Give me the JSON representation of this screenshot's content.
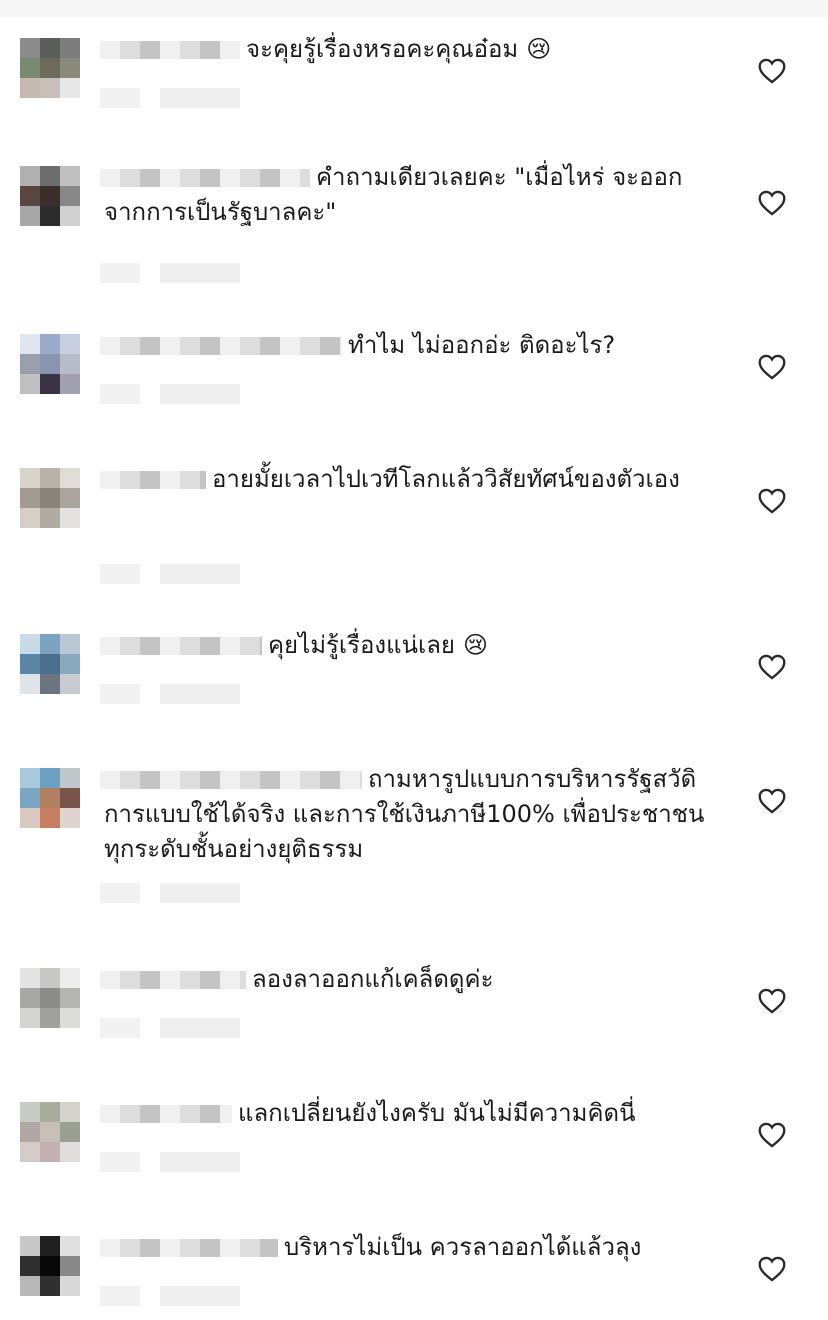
{
  "header": {
    "background": "#f7f7f7"
  },
  "colors": {
    "pixel_shades": [
      "#ffffff",
      "#f0f0f0",
      "#dddddd",
      "#c4c4c4",
      "#9b9b9b"
    ]
  },
  "comments": [
    {
      "text": "จะคุยรู้เรื่องหรอคะคุณอ๋อม",
      "emoji": "😢",
      "heart_icon": "heart-outline-icon",
      "avatar": [
        "#8c8c8c",
        "#5a5f5a",
        "#7d7d7d",
        "#7a8a70",
        "#6e6a5a",
        "#8a8a7a",
        "#c8b9b0",
        "#c8c0b8",
        "#e8e8e8"
      ]
    },
    {
      "text": "คำถามเดียวเลยคะ \"เมื่อไหร่ จะออก\nจากการเป็นรัฐบาลคะ\"",
      "emoji": "",
      "heart_icon": "heart-outline-icon",
      "avatar": [
        "#b0b0b0",
        "#6e6e6e",
        "#c0c0c0",
        "#5a4640",
        "#3c2e2a",
        "#888888",
        "#a8a8a8",
        "#2c2c2c",
        "#d0d0d0"
      ]
    },
    {
      "text": "ทำไม ไม่ออกอ่ะ ติดอะไร?",
      "emoji": "",
      "heart_icon": "heart-outline-icon",
      "avatar": [
        "#e0e6ee",
        "#9aaccc",
        "#c8d0e0",
        "#9aa0aa",
        "#8894b0",
        "#b8bcc8",
        "#c0c0c0",
        "#3c3246",
        "#a0a0b0"
      ]
    },
    {
      "text": "อายมั้ยเวลาไปเวทีโลกแล้ววิสัยทัศน์ของตัวเอง",
      "emoji": "",
      "heart_icon": "heart-outline-icon",
      "avatar": [
        "#d8d4cc",
        "#b8b2a8",
        "#e0ddd8",
        "#a49c90",
        "#8a8478",
        "#aaa59c",
        "#d4d0c8",
        "#b0aca4",
        "#e4e2de"
      ]
    },
    {
      "text": "คุยไม่รู้เรื่องแน่เลย",
      "emoji": "😢",
      "heart_icon": "heart-outline-icon",
      "avatar": [
        "#c8dce8",
        "#7aa4c0",
        "#b8c8d4",
        "#5a86a8",
        "#4a6e8c",
        "#8aa8bc",
        "#e0e4e8",
        "#6c7480",
        "#c8ccd0"
      ]
    },
    {
      "text": "ถามหารูปแบบการบริหารรัฐสวัดิ\nการแบบใช้ได้จริง และการใช้เงินภาษี100% เพื่อประชาชน\nทุกระดับชั้นอย่างยุติธรรม",
      "emoji": "",
      "heart_icon": "heart-outline-icon",
      "avatar": [
        "#a8c8dc",
        "#6aa0c4",
        "#c0c8cc",
        "#7aa6c4",
        "#b08060",
        "#7a5448",
        "#d8c8c0",
        "#c87c60",
        "#e0d4d0"
      ]
    },
    {
      "text": "ลองลาออกแก้เคล็ดดูค่ะ",
      "emoji": "",
      "heart_icon": "heart-outline-icon",
      "avatar": [
        "#e4e4e4",
        "#c8c8c4",
        "#ececec",
        "#a8a8a4",
        "#8c8c88",
        "#b4b4b0",
        "#d4d4d0",
        "#a0a09c",
        "#dcdcd8"
      ]
    },
    {
      "text": "แลกเปลี่ยนยังไงครับ มันไม่มีความคิดนี่",
      "emoji": "",
      "heart_icon": "heart-outline-icon",
      "avatar": [
        "#c8ccc4",
        "#a8ac9c",
        "#d4d4cc",
        "#b0a8a4",
        "#c8c0b8",
        "#9ca094",
        "#d4ccc8",
        "#c4b0b0",
        "#e0dcdc"
      ]
    },
    {
      "text": "บริหารไม่เป็น ควรลาออกได้แล้วลุง",
      "emoji": "",
      "heart_icon": "heart-outline-icon",
      "avatar": [
        "#c8c8c8",
        "#202020",
        "#e0e0e0",
        "#303030",
        "#080808",
        "#888888",
        "#b8b8b8",
        "#303030",
        "#d8d8d8"
      ]
    }
  ]
}
